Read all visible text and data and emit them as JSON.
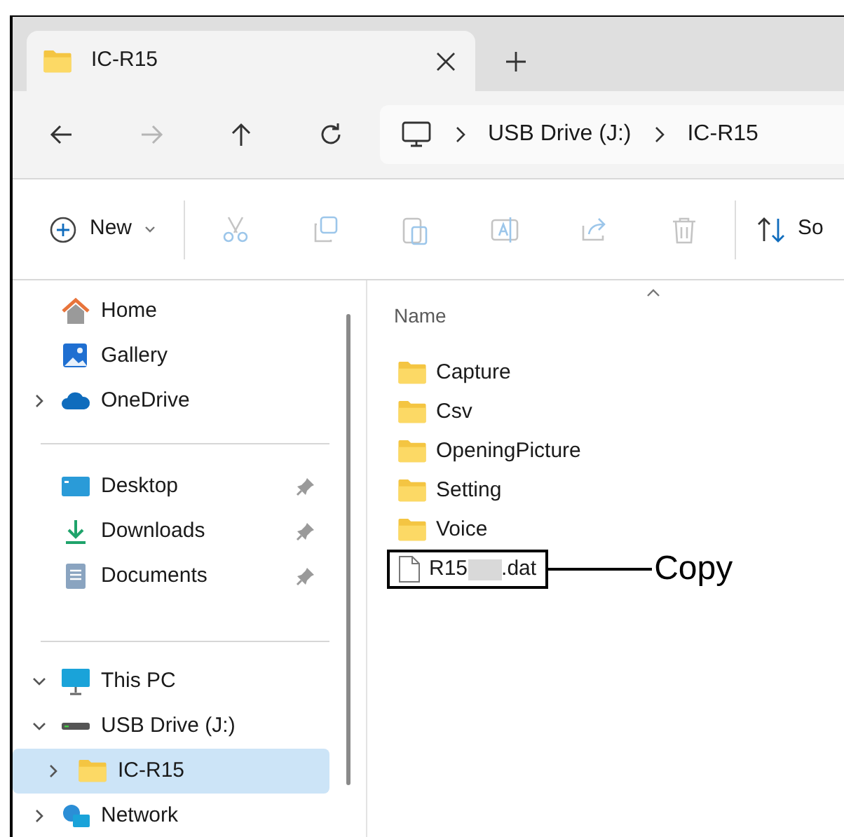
{
  "tab": {
    "title": "IC-R15",
    "selected": true
  },
  "nav": [
    {
      "kind": "back",
      "disabled": false
    },
    {
      "kind": "forward",
      "disabled": true
    },
    {
      "kind": "up",
      "disabled": false
    },
    {
      "kind": "refresh",
      "disabled": false
    }
  ],
  "breadcrumb": [
    "USB Drive (J:)",
    "IC-R15"
  ],
  "toolbar": {
    "new_label": "New",
    "actions": [
      {
        "kind": "cut",
        "disabled": true
      },
      {
        "kind": "copy",
        "disabled": true
      },
      {
        "kind": "paste",
        "disabled": true
      },
      {
        "kind": "rename",
        "disabled": true
      },
      {
        "kind": "share",
        "disabled": true
      },
      {
        "kind": "delete",
        "disabled": true
      }
    ],
    "sort_label": "So"
  },
  "sidebar": {
    "groups": [
      [
        {
          "kind": "home",
          "label": "Home",
          "selected": false
        },
        {
          "kind": "gallery",
          "label": "Gallery",
          "selected": false
        },
        {
          "kind": "cloud",
          "label": "OneDrive",
          "selected": false,
          "expanded": false
        }
      ],
      [
        {
          "kind": "desktop",
          "label": "Desktop",
          "selected": false,
          "pinned": true
        },
        {
          "kind": "download",
          "label": "Downloads",
          "selected": false,
          "pinned": true
        },
        {
          "kind": "document",
          "label": "Documents",
          "selected": false,
          "pinned": true
        }
      ],
      [
        {
          "kind": "pc",
          "label": "This PC",
          "selected": false,
          "expanded": true,
          "children": [
            {
              "kind": "drive",
              "label": "USB Drive (J:)",
              "selected": false,
              "expanded": true,
              "children": [
                {
                  "kind": "folder",
                  "label": "IC-R15",
                  "selected": true,
                  "expanded": false
                }
              ]
            }
          ]
        },
        {
          "kind": "network",
          "label": "Network",
          "selected": false,
          "expanded": false
        }
      ]
    ]
  },
  "files": {
    "column": "Name",
    "items": [
      {
        "kind": "folder",
        "name": "Capture"
      },
      {
        "kind": "folder",
        "name": "Csv"
      },
      {
        "kind": "folder",
        "name": "OpeningPicture"
      },
      {
        "kind": "folder",
        "name": "Setting"
      },
      {
        "kind": "folder",
        "name": "Voice"
      },
      {
        "kind": "file",
        "name_start": "R15",
        "name_end": ".dat",
        "callout": "Copy"
      }
    ]
  }
}
